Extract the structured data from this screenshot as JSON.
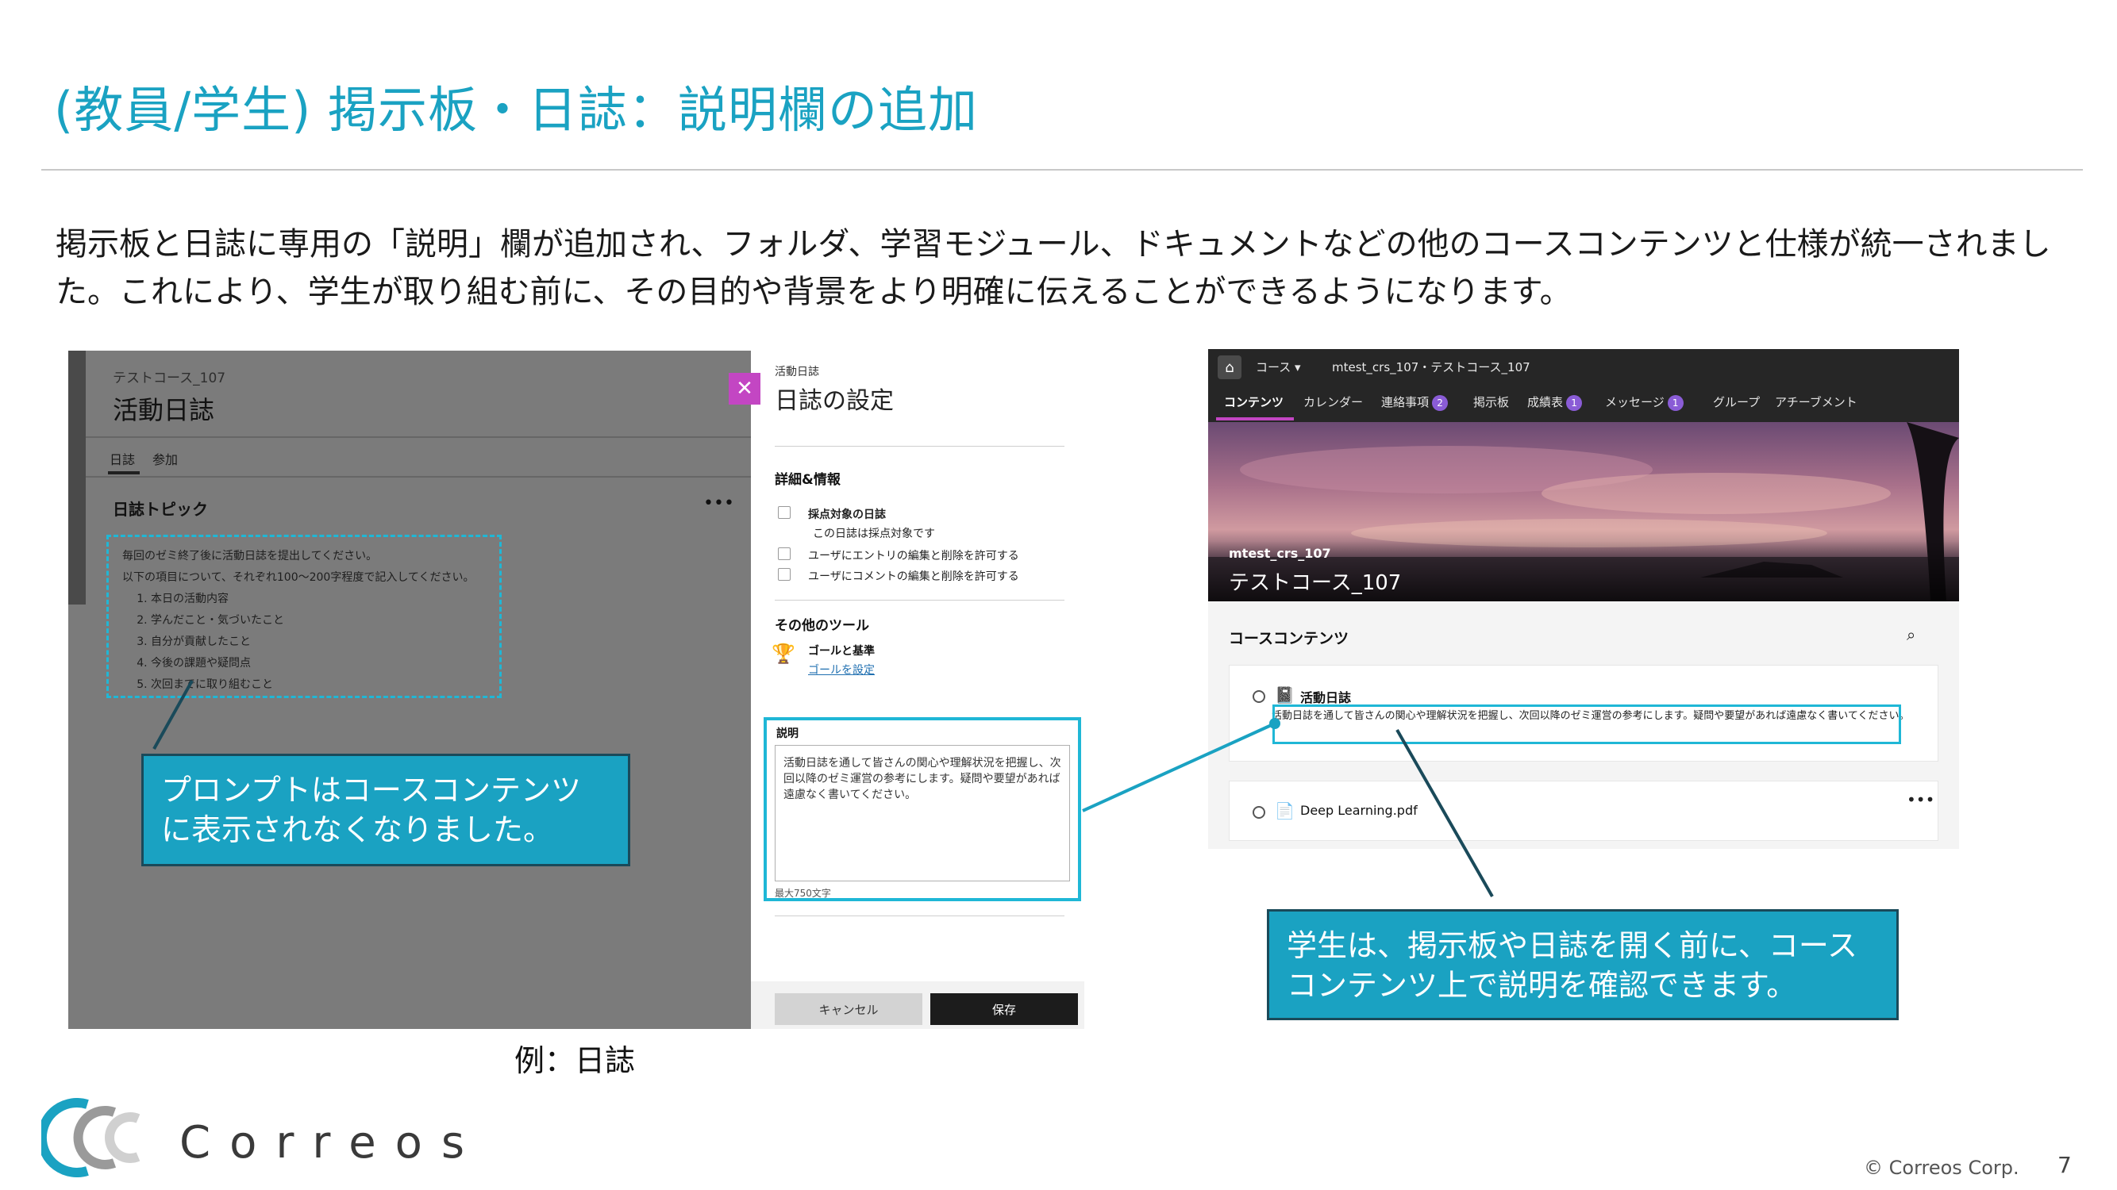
{
  "slide": {
    "title": "(教員/学生) 掲示板・日誌：説明欄の追加",
    "intro": "掲示板と日誌に専用の「説明」欄が追加され、フォルダ、学習モジュール、ドキュメントなどの他のコースコンテンツと仕様が統一されました。これにより、学生が取り組む前に、その目的や背景をより明確に伝えることができるようになります。",
    "example_caption": "例：日誌",
    "copyright": "© Correos Corp.",
    "page_number": "7",
    "logo_text": "Correos",
    "accent_color": "#1aa2c2"
  },
  "journal": {
    "course_name": "テストコース_107",
    "title": "活動日誌",
    "tabs": [
      "日誌",
      "参加"
    ],
    "topic_label": "日誌トピック",
    "more_icon": "more-horizontal-icon",
    "prompt_line1": "毎回のゼミ終了後に活動日誌を提出してください。",
    "prompt_line2": "以下の項目について、それぞれ100～200字程度で記入してください。",
    "prompt_items": [
      "本日の活動内容",
      "学んだこと・気づいたこと",
      "自分が貢献したこと",
      "今後の課題や疑問点",
      "次回までに取り組むこと"
    ]
  },
  "settings_panel": {
    "small_label": "活動日誌",
    "title": "日誌の設定",
    "close_icon": "close-icon",
    "section_details": "詳細&情報",
    "graded_label": "採点対象の日誌",
    "graded_note": "この日誌は採点対象です",
    "allow_edit_entries": "ユーザにエントリの編集と削除を許可する",
    "allow_edit_comments": "ユーザにコメントの編集と削除を許可する",
    "section_tools": "その他のツール",
    "goals_label": "ゴールと基準",
    "goals_link": "ゴールを設定",
    "description_label": "説明",
    "description_value": "活動日誌を通して皆さんの関心や理解状況を把握し、次回以降のゼミ運営の参考にします。疑問や要望があれば遠慮なく書いてください。",
    "max_length": "最大750文字",
    "cancel_label": "キャンセル",
    "save_label": "保存"
  },
  "callouts": {
    "left": "プロンプトはコースコンテンツに表示されなくなりました。",
    "right": "学生は、掲示板や日誌を開く前に、コースコンテンツ上で説明を確認できます。"
  },
  "course_page": {
    "course_menu": "コース ▾",
    "breadcrumb": "mtest_crs_107・テストコース_107",
    "nav": [
      {
        "label": "コンテンツ",
        "badge": ""
      },
      {
        "label": "カレンダー",
        "badge": ""
      },
      {
        "label": "連絡事項",
        "badge": "2"
      },
      {
        "label": "掲示板",
        "badge": ""
      },
      {
        "label": "成績表",
        "badge": "1"
      },
      {
        "label": "メッセージ",
        "badge": "1"
      },
      {
        "label": "グループ",
        "badge": ""
      },
      {
        "label": "アチーブメント",
        "badge": ""
      }
    ],
    "course_code": "mtest_crs_107",
    "course_name": "テストコース_107",
    "contents_title": "コースコンテンツ",
    "item1_title": "活動日誌",
    "item1_description": "活動日誌を通して皆さんの関心や理解状況を把握し、次回以降のゼミ運営の参考にします。疑問や要望があれば遠慮なく書いてください。",
    "item2_title": "Deep Learning.pdf"
  }
}
